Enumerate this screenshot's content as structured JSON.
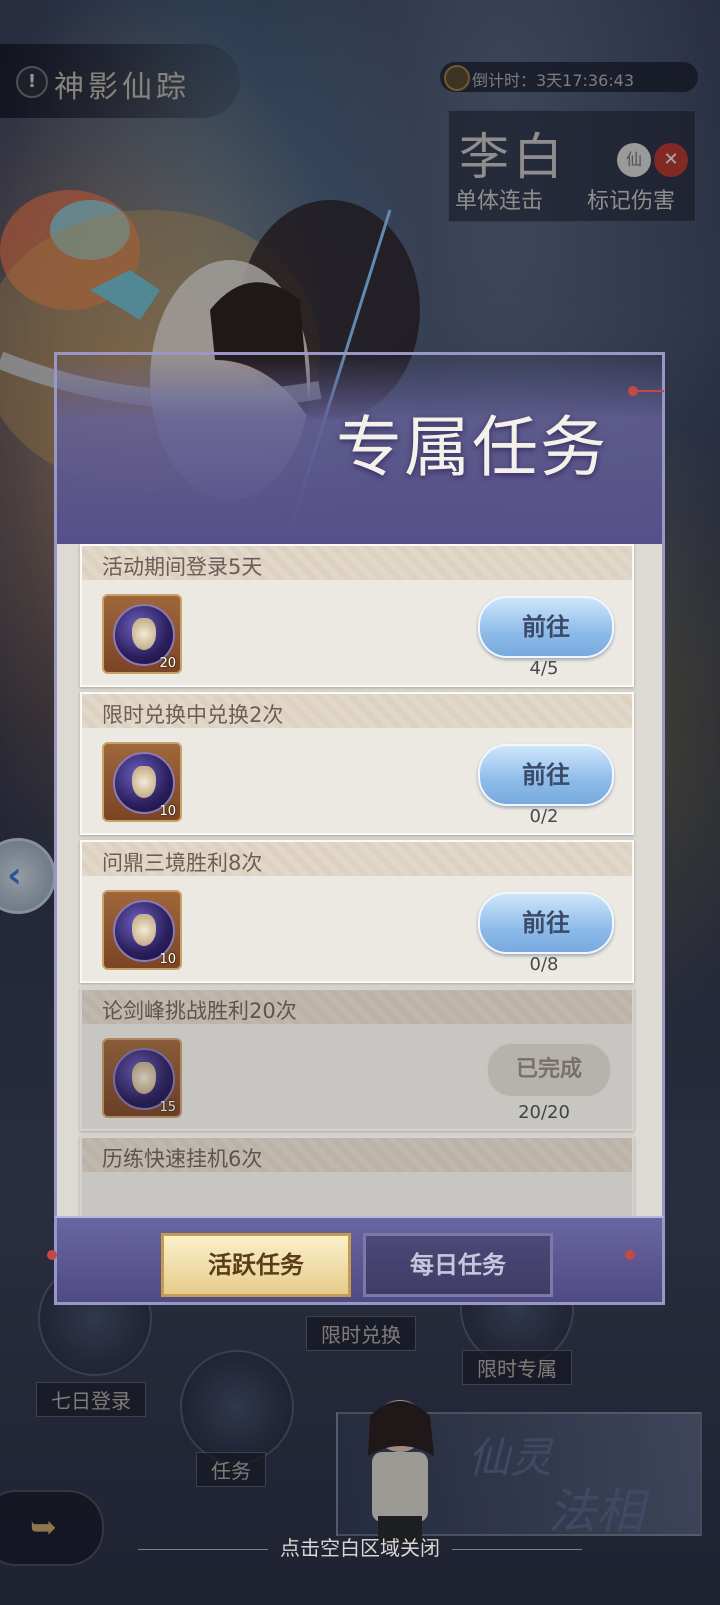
{
  "background": {
    "event_title": "神影仙踪",
    "countdown": "倒计时：3天17:36:43",
    "hero": {
      "name": "李白",
      "badge_xian": "仙",
      "tag_1": "单体连击",
      "tag_2": "标记伤害"
    },
    "bottom_nav": [
      {
        "label": "七日登录"
      },
      {
        "label": "任务"
      },
      {
        "label": "限时兑换"
      },
      {
        "label": "限时专属"
      }
    ],
    "fairy_banner": {
      "line1": "仙灵",
      "line2": "法相"
    },
    "close_hint": "点击空白区域关闭"
  },
  "dialog": {
    "title": "专属任务",
    "tasks": [
      {
        "name": "活动期间登录5天",
        "reward_qty": "20",
        "button": "前往",
        "progress": "4/5",
        "completed": false
      },
      {
        "name": "限时兑换中兑换2次",
        "reward_qty": "10",
        "button": "前往",
        "progress": "0/2",
        "completed": false
      },
      {
        "name": "问鼎三境胜利8次",
        "reward_qty": "10",
        "button": "前往",
        "progress": "0/8",
        "completed": false
      },
      {
        "name": "论剑峰挑战胜利20次",
        "reward_qty": "15",
        "button": "已完成",
        "progress": "20/20",
        "completed": true
      },
      {
        "name": "历练快速挂机6次",
        "reward_qty": "",
        "button": "",
        "progress": "",
        "completed": false
      }
    ],
    "tabs": [
      {
        "label": "活跃任务",
        "active": true
      },
      {
        "label": "每日任务",
        "active": false
      }
    ]
  },
  "colors": {
    "go_button": "#8dbbe9",
    "active_tab": "#e6cc8c",
    "dialog_frame": "#55508a"
  }
}
